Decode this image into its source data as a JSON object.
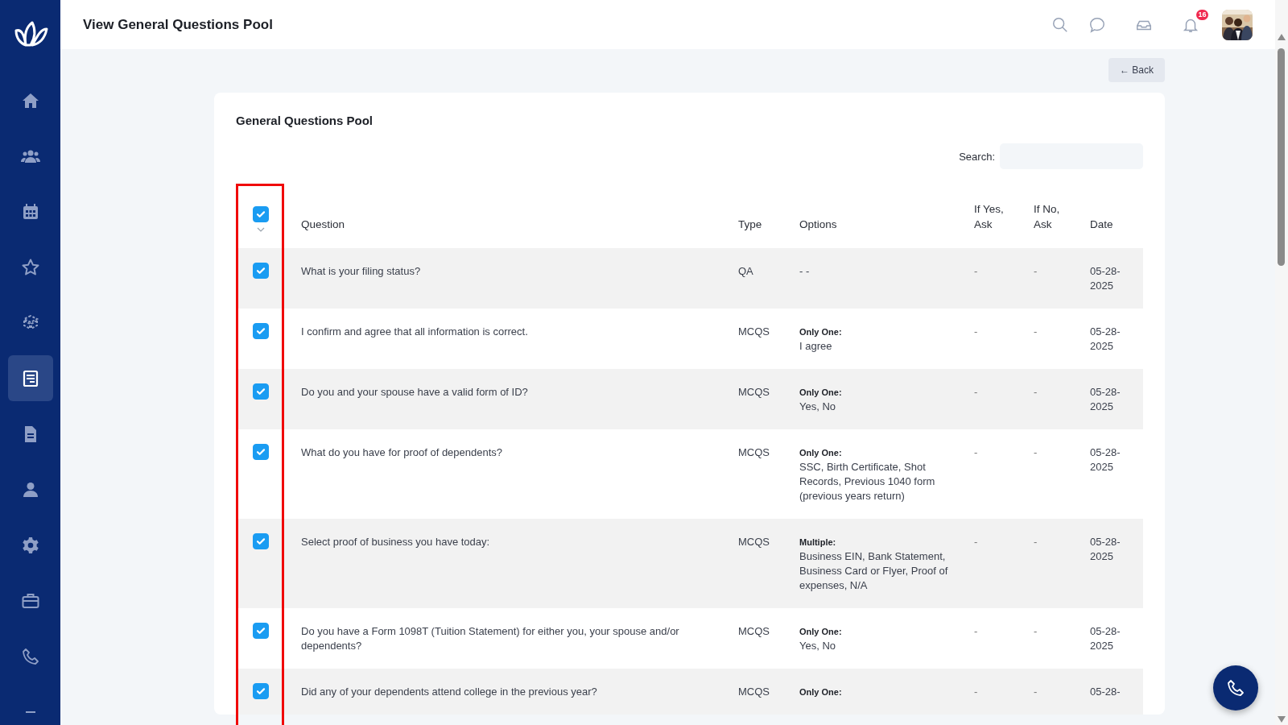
{
  "sidebar": {
    "items": [
      {
        "selected": false
      },
      {
        "selected": false
      },
      {
        "selected": false
      },
      {
        "selected": false
      },
      {
        "selected": false
      },
      {
        "selected": true
      },
      {
        "selected": false
      },
      {
        "selected": false
      },
      {
        "selected": false
      },
      {
        "selected": false
      },
      {
        "selected": false
      },
      {
        "selected": false
      }
    ]
  },
  "header": {
    "title": "View General Questions Pool",
    "notifications_badge": "16"
  },
  "back_button": {
    "label": "← Back"
  },
  "card": {
    "title": "General Questions Pool",
    "search": {
      "label": "Search:"
    },
    "column_highlight": true
  },
  "table": {
    "select_all": {
      "checked": true
    },
    "columns": [
      "Question",
      "Type",
      "Options",
      "If Yes, Ask",
      "If No, Ask",
      "Date"
    ],
    "rows": [
      {
        "checked": true,
        "question": "What is your filing status?",
        "type": "QA",
        "options": {
          "value": "- -"
        },
        "if_yes": "-",
        "if_no": "-",
        "date": "05-28-2025"
      },
      {
        "checked": true,
        "question": "I confirm and agree that all information is correct.",
        "type": "MCQS",
        "options": {
          "label": "Only One:",
          "value": "I agree"
        },
        "if_yes": "-",
        "if_no": "-",
        "date": "05-28-2025"
      },
      {
        "checked": true,
        "question": "Do you and your spouse have a valid form of ID?",
        "type": "MCQS",
        "options": {
          "label": "Only One:",
          "value": "Yes, No"
        },
        "if_yes": "-",
        "if_no": "-",
        "date": "05-28-2025"
      },
      {
        "checked": true,
        "question": "What do you have for proof of dependents?",
        "type": "MCQS",
        "options": {
          "label": "Only One:",
          "value": "SSC, Birth Certificate, Shot Records, Previous 1040 form (previous years return)"
        },
        "if_yes": "-",
        "if_no": "-",
        "date": "05-28-2025"
      },
      {
        "checked": true,
        "question": "Select proof of business you have today:",
        "type": "MCQS",
        "options": {
          "label": "Multiple:",
          "value": "Business EIN, Bank Statement, Business Card or Flyer, Proof of expenses, N/A"
        },
        "if_yes": "-",
        "if_no": "-",
        "date": "05-28-2025"
      },
      {
        "checked": true,
        "question": "Do you have a Form 1098T (Tuition Statement) for either you, your spouse and/or dependents?",
        "type": "MCQS",
        "options": {
          "label": "Only One:",
          "value": "Yes, No"
        },
        "if_yes": "-",
        "if_no": "-",
        "date": "05-28-2025"
      },
      {
        "checked": true,
        "question": "Did any of your dependents attend college in the previous year?",
        "type": "MCQS",
        "options": {
          "label": "Only One:"
        },
        "if_yes": "-",
        "if_no": "-",
        "date": "05-28-"
      }
    ]
  }
}
